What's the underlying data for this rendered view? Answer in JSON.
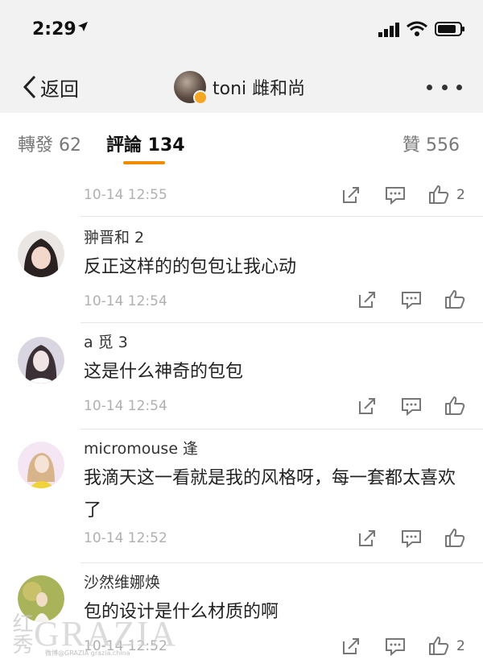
{
  "status_bar": {
    "time": "2:29"
  },
  "nav": {
    "back_label": "返回",
    "profile_name": "toni 雌和尚"
  },
  "tabs": [
    {
      "label": "轉發 62"
    },
    {
      "label": "評論 134"
    },
    {
      "label": "贊 556"
    }
  ],
  "comments": [
    {
      "time": "10-14 12:55",
      "likes": "2"
    },
    {
      "user": "翀晋和 2",
      "text": "反正这样的的包包让我心动",
      "time": "10-14 12:54",
      "likes": ""
    },
    {
      "user": "a 觅 3",
      "text": "这是什么神奇的包包",
      "time": "10-14 12:54",
      "likes": ""
    },
    {
      "user": "micromouse 逢",
      "text": "我滴天这一看就是我的风格呀，每一套都太喜欢了",
      "time": "10-14 12:52",
      "likes": ""
    },
    {
      "user": "沙然维娜焕",
      "text": "包的设计是什么材质的啊",
      "time": "10-14 12:52",
      "likes": "2"
    }
  ],
  "watermark": {
    "cn": "红秀",
    "brand": "GRAZIA",
    "credit": "微博@GRAZIA  grazia.china"
  },
  "colors": {
    "accent": "#f08c00",
    "badge": "#f5a623"
  }
}
